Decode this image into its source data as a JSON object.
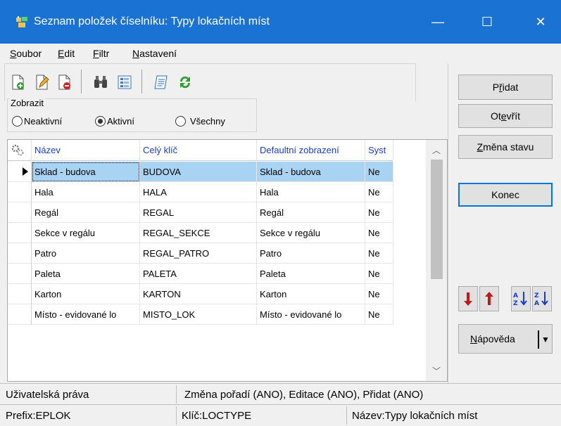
{
  "window": {
    "title": "Seznam položek číselníku: Typy lokačních míst",
    "min": "—",
    "max": "☐",
    "close": "✕"
  },
  "menu": [
    {
      "pre": "",
      "u": "S",
      "post": "oubor"
    },
    {
      "pre": "",
      "u": "E",
      "post": "dit"
    },
    {
      "pre": "",
      "u": "F",
      "post": "iltr"
    },
    {
      "pre": "",
      "u": "N",
      "post": "astavení"
    }
  ],
  "filter": {
    "legend": "Zobrazit",
    "options": [
      "Neaktivní",
      "Aktivní",
      "Všechny"
    ],
    "selected": "Aktivní"
  },
  "grid": {
    "columns": [
      "Název",
      "Celý klíč",
      "Defaultní zobrazení",
      "Syst"
    ],
    "rows": [
      [
        "Sklad - budova",
        "BUDOVA",
        "Sklad - budova",
        "Ne"
      ],
      [
        "Hala",
        "HALA",
        "Hala",
        "Ne"
      ],
      [
        "Regál",
        "REGAL",
        "Regál",
        "Ne"
      ],
      [
        "Sekce v regálu",
        "REGAL_SEKCE",
        "Sekce v regálu",
        "Ne"
      ],
      [
        "Patro",
        "REGAL_PATRO",
        "Patro",
        "Ne"
      ],
      [
        "Paleta",
        "PALETA",
        "Paleta",
        "Ne"
      ],
      [
        "Karton",
        "KARTON",
        "Karton",
        "Ne"
      ],
      [
        "Místo - evidované lo",
        "MISTO_LOK",
        "Místo - evidované lo",
        "Ne"
      ]
    ],
    "selected_row": 0
  },
  "buttons": {
    "pridat": {
      "pre": "P",
      "u": "ř",
      "post": "idat"
    },
    "otevrit": {
      "pre": "Ot",
      "u": "e",
      "post": "vřít"
    },
    "zmena_stavu": {
      "pre": "",
      "u": "Z",
      "post": "měna stavu"
    },
    "konec": "Konec",
    "napoveda": {
      "pre": "",
      "u": "N",
      "post": "ápověda"
    }
  },
  "status": {
    "rights_label": "Uživatelská práva",
    "rights_value": "Změna pořadí (ANO), Editace (ANO), Přidat (ANO)",
    "prefix": "Prefix:EPLOK",
    "key": "Klíč:LOCTYPE",
    "name": "Název:Typy lokačních míst"
  },
  "colors": {
    "titlebar": "#1a73d2",
    "header_text": "#1a3cc8",
    "selection": "#a9d3f3",
    "focus_border": "#0078d7"
  }
}
